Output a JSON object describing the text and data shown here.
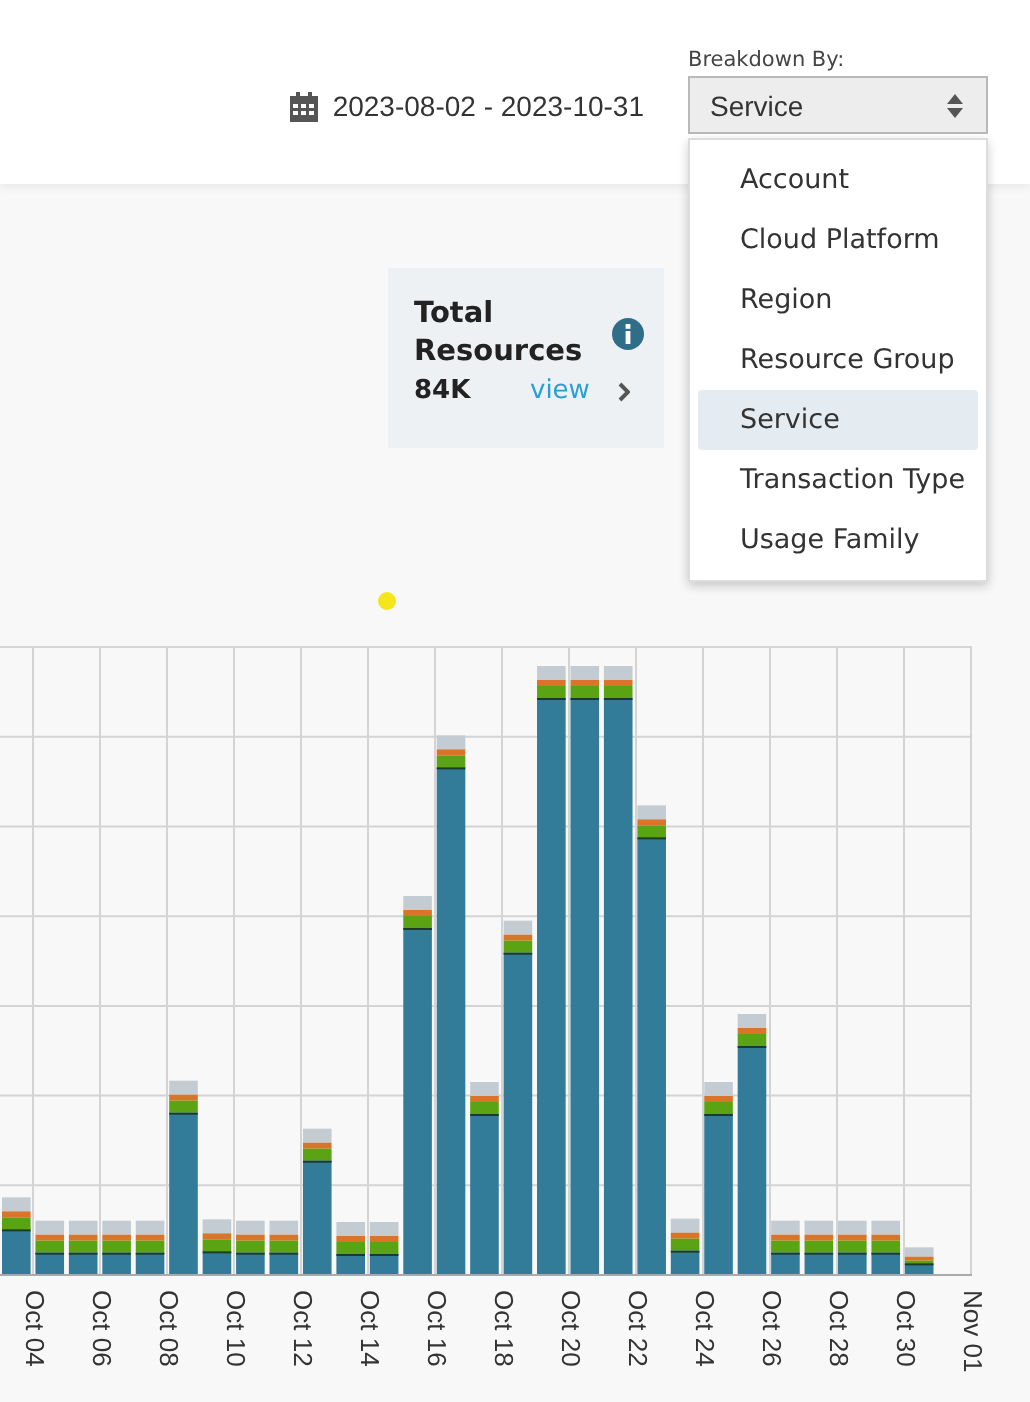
{
  "date_range": {
    "text": "2023-08-02 - 2023-10-31"
  },
  "breakdown": {
    "label": "Breakdown By:",
    "value": "Service",
    "expanded": true,
    "options": [
      {
        "label": "Account",
        "selected": false
      },
      {
        "label": "Cloud Platform",
        "selected": false
      },
      {
        "label": "Region",
        "selected": false
      },
      {
        "label": "Resource Group",
        "selected": false
      },
      {
        "label": "Service",
        "selected": true
      },
      {
        "label": "Transaction Type",
        "selected": false
      },
      {
        "label": "Usage Family",
        "selected": false
      }
    ]
  },
  "summary_card": {
    "title": "Total Resources",
    "value": "84K",
    "link": "view"
  },
  "chart": {
    "x_labels": [
      "Oct 04",
      "Oct 06",
      "Oct 08",
      "Oct 10",
      "Oct 12",
      "Oct 14",
      "Oct 16",
      "Oct 18",
      "Oct 20",
      "Oct 22",
      "Oct 24",
      "Oct 26",
      "Oct 28",
      "Oct 30",
      "Nov 01"
    ]
  }
}
